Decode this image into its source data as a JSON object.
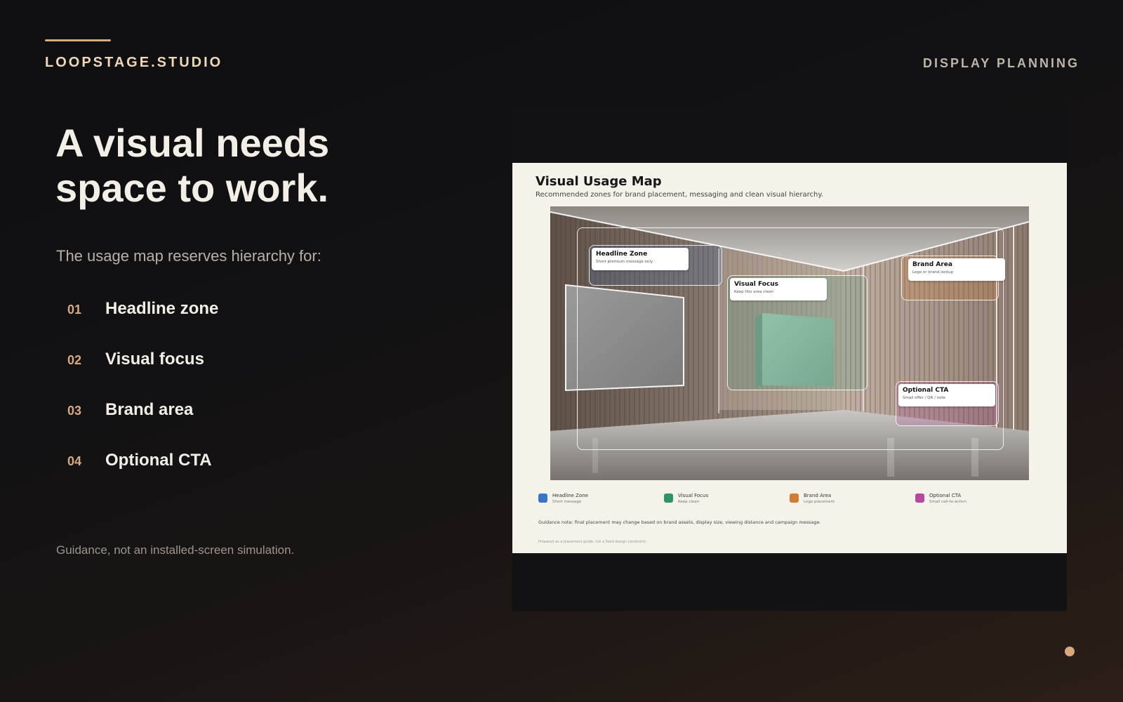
{
  "header": {
    "brand": "LOOPSTAGE.STUDIO",
    "section": "DISPLAY PLANNING"
  },
  "hero": {
    "headline": "A visual needs space to work.",
    "intro": "The usage map reserves hierarchy for:",
    "items": [
      {
        "num": "01",
        "label": "Headline zone"
      },
      {
        "num": "02",
        "label": "Visual focus"
      },
      {
        "num": "03",
        "label": "Brand area"
      },
      {
        "num": "04",
        "label": "Optional CTA"
      }
    ],
    "footnote": "Guidance, not an installed-screen simulation."
  },
  "usage_map": {
    "title": "Visual Usage Map",
    "subtitle": "Recommended zones for brand placement, messaging and clean visual hierarchy.",
    "zones": [
      {
        "title": "Headline Zone",
        "subtitle": "Short premium message only",
        "color": "#3a73c9"
      },
      {
        "title": "Visual Focus",
        "subtitle": "Keep this area clean",
        "color": "#2e9467"
      },
      {
        "title": "Brand Area",
        "subtitle": "Logo or brand lockup",
        "color": "#d17c32"
      },
      {
        "title": "Optional CTA",
        "subtitle": "Small offer / QR / note",
        "color": "#b8489c"
      }
    ],
    "legend": [
      {
        "name": "Headline Zone",
        "desc": "Short message",
        "color": "#3a73c9"
      },
      {
        "name": "Visual Focus",
        "desc": "Keep clean",
        "color": "#2e9467"
      },
      {
        "name": "Brand Area",
        "desc": "Logo placement",
        "color": "#d17c32"
      },
      {
        "name": "Optional CTA",
        "desc": "Small call-to-action",
        "color": "#b8489c"
      }
    ],
    "guidance": "Guidance note: final placement may change based on brand assets, display size, viewing distance and campaign message.",
    "prepared": "Prepared as a placement guide, not a fixed design constraint."
  },
  "colors": {
    "accent": "#d8aa7c",
    "background": "#121113",
    "paper": "#f5f2ea"
  }
}
